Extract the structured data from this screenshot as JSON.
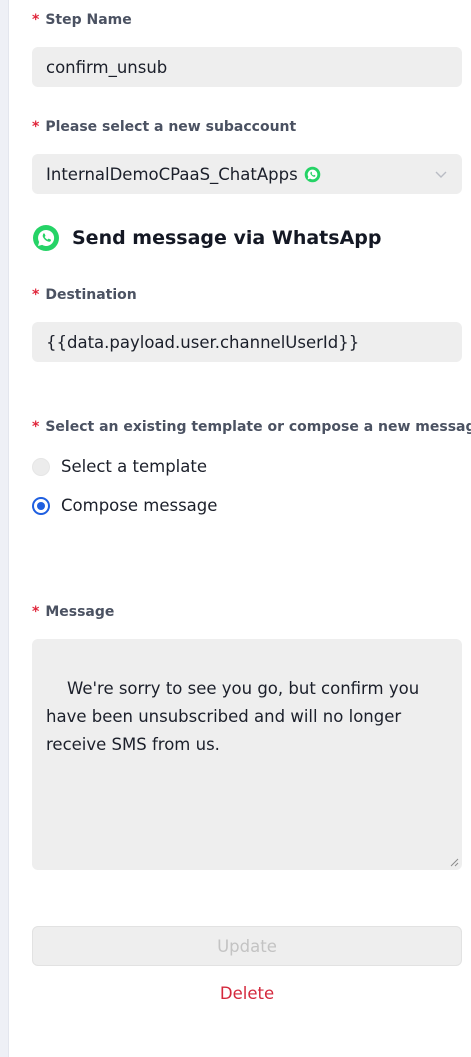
{
  "step_name": {
    "label": "Step Name",
    "value": "confirm_unsub"
  },
  "subaccount": {
    "label": "Please select a new subaccount",
    "value": "InternalDemoCPaaS_ChatApps",
    "channel_icon": "whatsapp-icon"
  },
  "section": {
    "title": "Send message via WhatsApp",
    "icon": "whatsapp-icon",
    "icon_color": "#25D366"
  },
  "destination": {
    "label": "Destination",
    "value": "{{data.payload.user.channelUserId}}"
  },
  "message_source": {
    "label": "Select an existing template or compose a new message",
    "options": [
      {
        "label": "Select a template",
        "selected": false
      },
      {
        "label": "Compose message",
        "selected": true
      }
    ]
  },
  "message": {
    "label": "Message",
    "value": "We're sorry to see you go, but confirm you have been unsubscribed and will no longer receive SMS from us."
  },
  "actions": {
    "update_label": "Update",
    "delete_label": "Delete"
  },
  "required_marker": "*",
  "colors": {
    "accent": "#1f5fe0",
    "danger": "#d4283c",
    "required": "#e0263b",
    "field_bg": "#eeeeee"
  }
}
